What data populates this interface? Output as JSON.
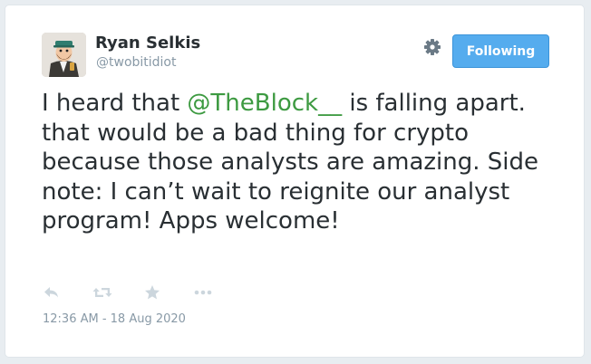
{
  "user": {
    "display_name": "Ryan Selkis",
    "handle": "@twobitidiot"
  },
  "follow_button": {
    "label": "Following"
  },
  "tweet": {
    "text_before": "I heard that ",
    "mention": "@TheBlock__",
    "text_after": " is falling apart. that would be a bad thing for crypto because those analysts are amazing. Side note: I can’t wait to reignite our analyst program! Apps welcome!",
    "timestamp": "12:36 AM - 18 Aug 2020"
  },
  "icons": {
    "settings": "gear-icon",
    "reply": "reply-icon",
    "retweet": "retweet-icon",
    "favorite": "star-icon",
    "more": "more-icon"
  },
  "colors": {
    "button_blue": "#55acee",
    "mention_green": "#3d9a41",
    "text_dark": "#292f33",
    "text_muted": "#8899a6",
    "icon_gray": "#ccd6dd"
  }
}
